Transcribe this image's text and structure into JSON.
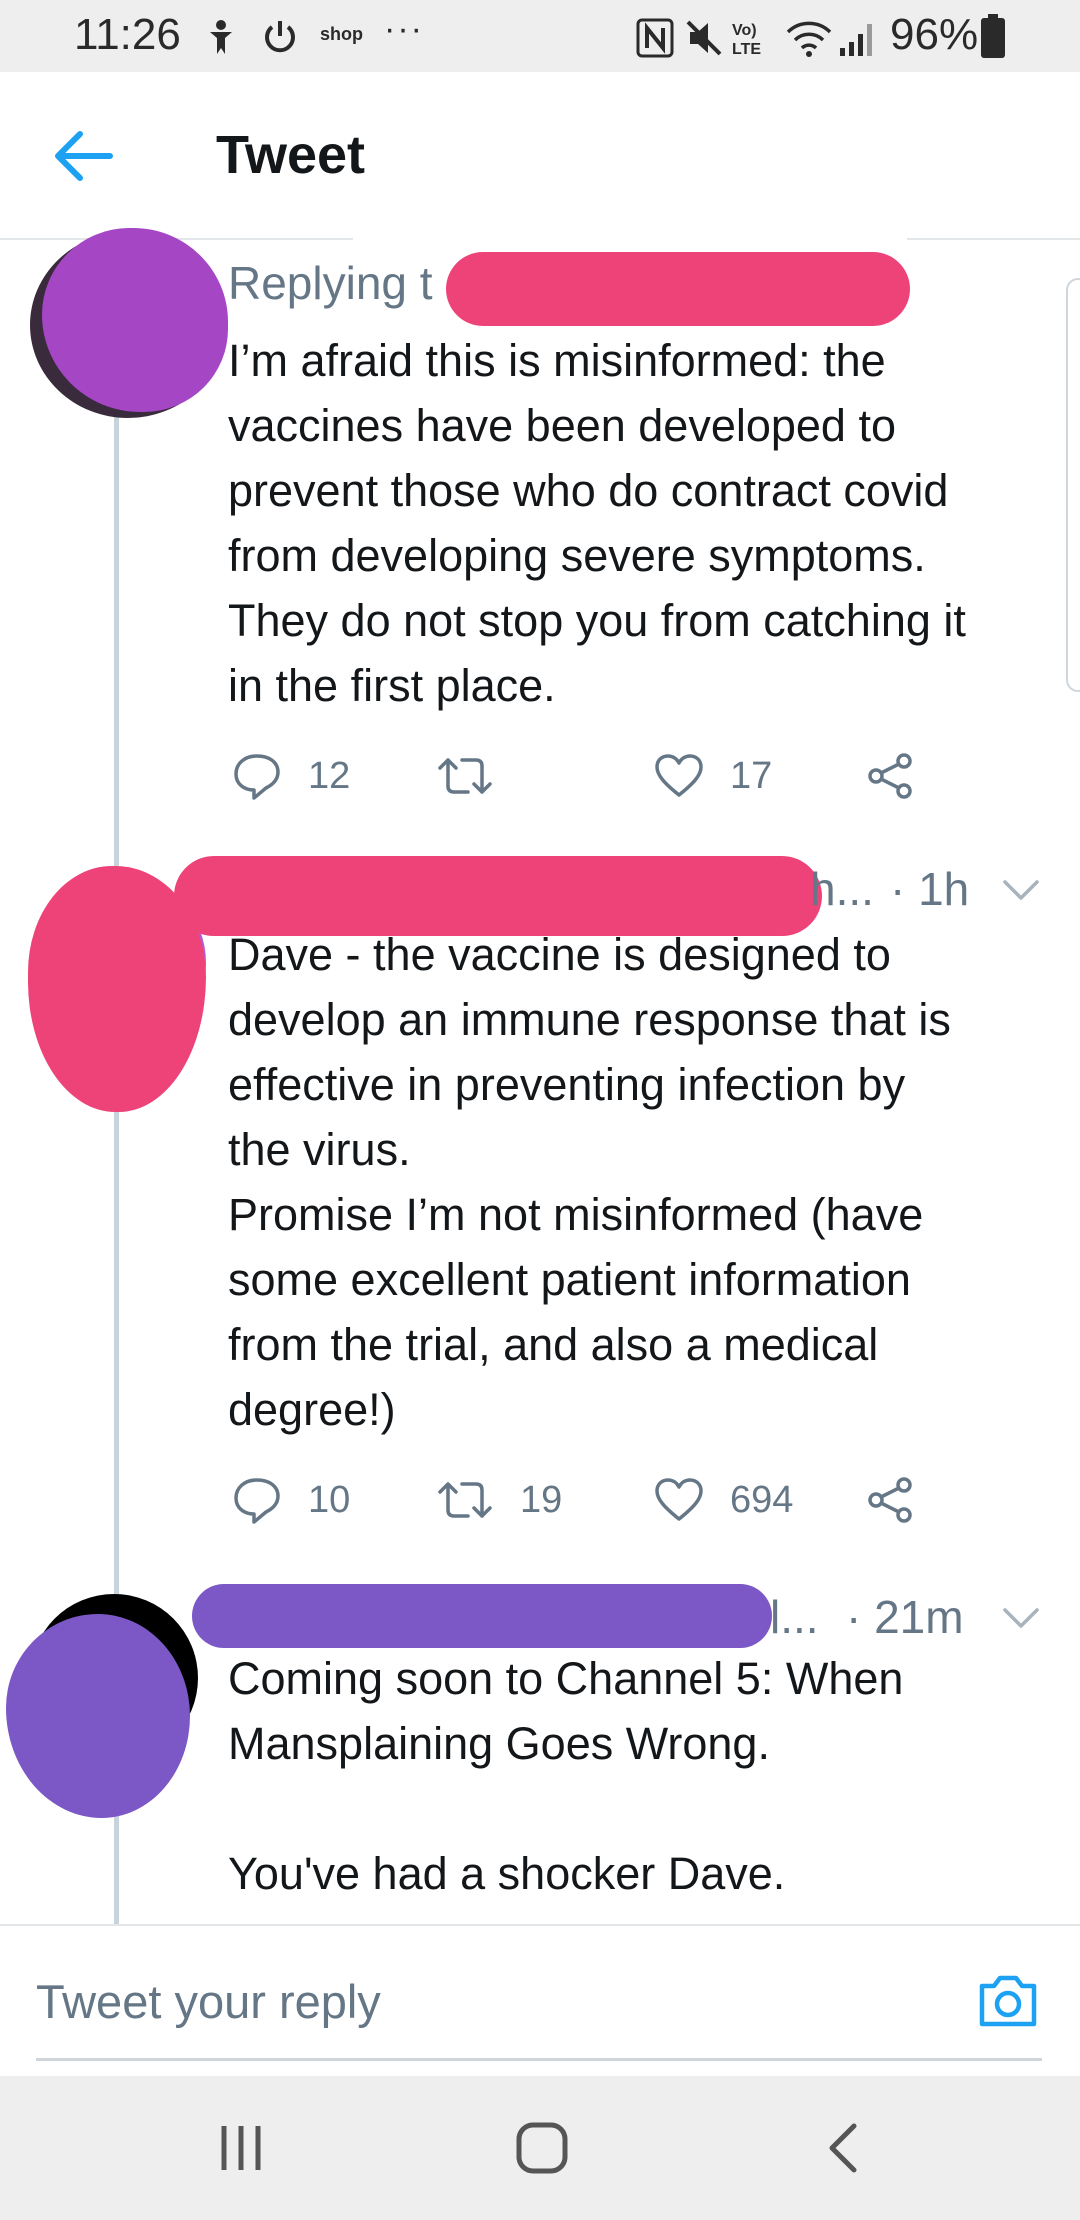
{
  "status_bar": {
    "time": "11:26",
    "shop_label": "shop",
    "overflow": "···",
    "battery": "96%",
    "icons": [
      "accessibility-icon",
      "power-icon",
      "nfc-icon",
      "mute-icon",
      "volte-icon",
      "wifi-icon",
      "signal-icon",
      "battery-icon"
    ]
  },
  "header": {
    "back_icon": "arrow-left-icon",
    "title": "Tweet"
  },
  "tweets": [
    {
      "replying_prefix": "Replying t",
      "text": "I’m afraid this is misinformed: the\nvaccines have been developed to\nprevent those who do contract covid\nfrom developing severe symptoms.\nThey do not stop you from catching it\nin the first place.",
      "replies": "12",
      "retweets": "",
      "likes": "17"
    },
    {
      "meta_tail": "h...",
      "time": "· 1h",
      "text": "Dave - the vaccine is designed to\ndevelop an immune response that is\neffective in preventing infection by\nthe virus.\nPromise I’m not misinformed (have\nsome excellent patient information\nfrom the trial, and also a medical\ndegree!)",
      "replies": "10",
      "retweets": "19",
      "likes": "694"
    },
    {
      "meta_tail": "l...",
      "time": "· 21m",
      "text": "Coming soon to Channel 5: When\nMansplaining Goes Wrong.\n\nYou've had a shocker Dave."
    }
  ],
  "composer": {
    "placeholder": "Tweet your reply",
    "camera_icon": "camera-icon"
  },
  "navigation": [
    "recent-apps-icon",
    "home-icon",
    "back-icon"
  ],
  "colors": {
    "twitter_blue": "#1DA1F2",
    "redaction_pink": "#EE4379",
    "redaction_purple": "#7C57C6",
    "avatar_magenta": "#A546C4",
    "muted_gray": "#657786"
  }
}
